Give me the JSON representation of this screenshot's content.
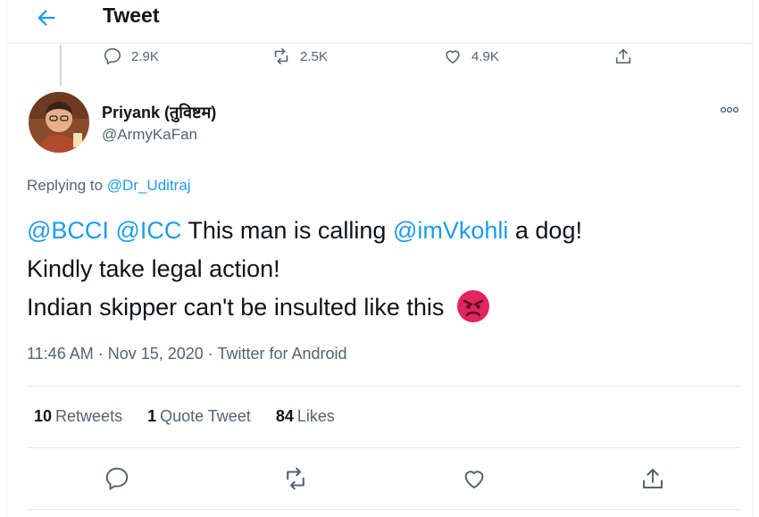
{
  "header": {
    "title": "Tweet"
  },
  "parent_stats": {
    "replies": "2.9K",
    "retweets": "2.5K",
    "likes": "4.9K"
  },
  "author": {
    "name": "Priyank (तुविष्टम)",
    "handle": "@ArmyKaFan"
  },
  "replying": {
    "prefix": "Replying to ",
    "handle": "@Dr_Uditraj"
  },
  "tweet": {
    "line1": {
      "m1": "@BCCI",
      "m2": "@ICC",
      "t1": " This man is calling ",
      "m3": "@imVkohli",
      "t2": " a dog!"
    },
    "line2": "Kindly take legal action!",
    "line3": "Indian skipper can't be insulted like this"
  },
  "meta": "11:46 AM · Nov 15, 2020 · Twitter for Android",
  "counts": {
    "retweets_num": "10",
    "retweets_label": "Retweets",
    "quotes_num": "1",
    "quotes_label": "Quote Tweet",
    "likes_num": "84",
    "likes_label": "Likes"
  },
  "icons": [
    "back-arrow-icon",
    "reply-icon",
    "retweet-icon",
    "like-icon",
    "share-icon",
    "more-icon",
    "angry-face-emoji"
  ],
  "colors": {
    "accent": "#1d9bf0",
    "muted": "#536471",
    "text": "#0f1419",
    "emoji": "#e0245e"
  }
}
